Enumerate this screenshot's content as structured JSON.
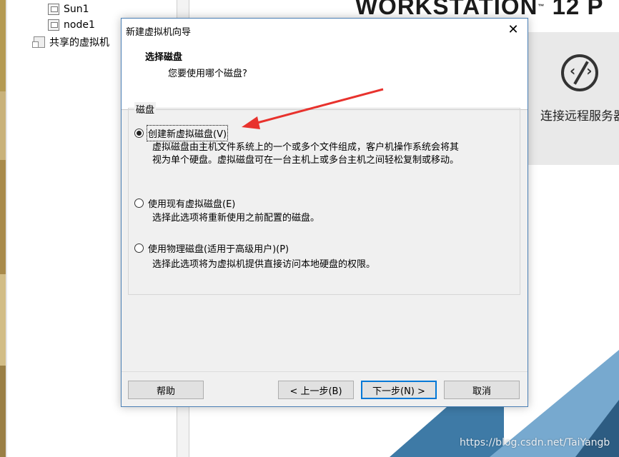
{
  "tree": {
    "items": [
      {
        "label": "Sun1",
        "icon": "vm-icon"
      },
      {
        "label": "node1",
        "icon": "vm-icon"
      },
      {
        "label": "共享的虚拟机",
        "icon": "shared-vms-icon"
      }
    ]
  },
  "home": {
    "brand": "WORKSTATION",
    "brand_tm": "™",
    "brand_version": "12 P",
    "connect_label": "连接远程服务器",
    "watermark": "https://blog.csdn.net/TaiYangb"
  },
  "dialog": {
    "title": "新建虚拟机向导",
    "close_glyph": "✕",
    "header_title": "选择磁盘",
    "header_subtitle": "您要使用哪个磁盘?",
    "group_label": "磁盘",
    "options": [
      {
        "label": "创建新虚拟磁盘(V)",
        "checked": true,
        "desc_lines": [
          "虚拟磁盘由主机文件系统上的一个或多个文件组成，客户机操作系统会将其",
          "视为单个硬盘。虚拟磁盘可在一台主机上或多台主机之间轻松复制或移动。"
        ]
      },
      {
        "label": "使用现有虚拟磁盘(E)",
        "checked": false,
        "desc_lines": [
          "选择此选项将重新使用之前配置的磁盘。"
        ]
      },
      {
        "label": "使用物理磁盘(适用于高级用户)(P)",
        "checked": false,
        "desc_lines": [
          "选择此选项将为虚拟机提供直接访问本地硬盘的权限。"
        ]
      }
    ],
    "buttons": {
      "help": "帮助",
      "back": "< 上一步(B)",
      "next": "下一步(N) >",
      "cancel": "取消"
    }
  },
  "colors": {
    "dialog_border": "#4a7fb5",
    "arrow": "#e8322d",
    "default_button": "#0078d7"
  }
}
